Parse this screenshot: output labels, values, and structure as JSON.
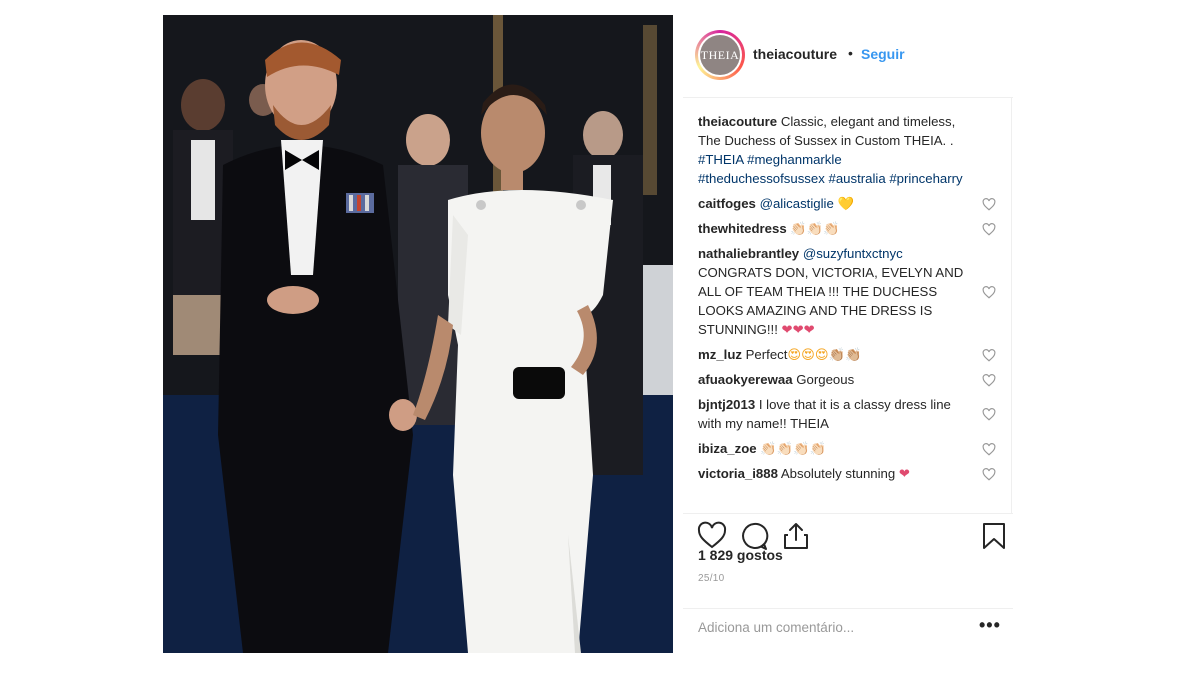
{
  "post": {
    "username": "theiacouture",
    "avatar_text": "THEIA",
    "follow_label": "Seguir",
    "separator": "•"
  },
  "caption": {
    "user": "theiacouture",
    "text": "Classic, elegant and timeless, The Duchess of Sussex in Custom THEIA. .",
    "hashtags": "#THEIA #meghanmarkle #theduchessofsussex #australia #princeharry"
  },
  "comments": [
    {
      "user": "caitfoges",
      "mention": "@alicastiglie",
      "text": "",
      "emoji": "💛"
    },
    {
      "user": "thewhitedress",
      "mention": "",
      "text": "",
      "emoji": "👏🏻👏🏻👏🏻"
    },
    {
      "user": "nathaliebrantley",
      "mention": "@suzyfuntxctnyc",
      "text": "CONGRATS DON, VICTORIA, EVELYN AND ALL OF TEAM THEIA !!! THE DUCHESS LOOKS AMAZING AND THE DRESS IS STUNNING!!!",
      "emoji": "❤❤❤"
    },
    {
      "user": "mz_luz",
      "mention": "",
      "text": "Perfect",
      "emoji": "😍😍😍👏🏼👏🏼"
    },
    {
      "user": "afuaokyerewaa",
      "mention": "",
      "text": "Gorgeous",
      "emoji": ""
    },
    {
      "user": "bjntj2013",
      "mention": "",
      "text": "I love that it is a classy dress line with my name!! THEIA",
      "emoji": ""
    },
    {
      "user": "ibiza_zoe",
      "mention": "",
      "text": "",
      "emoji": "👏🏻👏🏻👏🏻👏🏻"
    },
    {
      "user": "victoria_i888",
      "mention": "",
      "text": "Absolutely stunning",
      "emoji": "❤"
    }
  ],
  "footer": {
    "likes": "1 829 gostos",
    "date": "25/10",
    "comment_placeholder": "Adiciona um comentário...",
    "more_label": "•••"
  },
  "icons": {
    "like": "heart-icon",
    "comment": "comment-icon",
    "share": "share-icon",
    "save": "bookmark-icon"
  },
  "colors": {
    "link": "#3897f0",
    "hashtag": "#003569",
    "text": "#262626",
    "muted": "#999999"
  }
}
